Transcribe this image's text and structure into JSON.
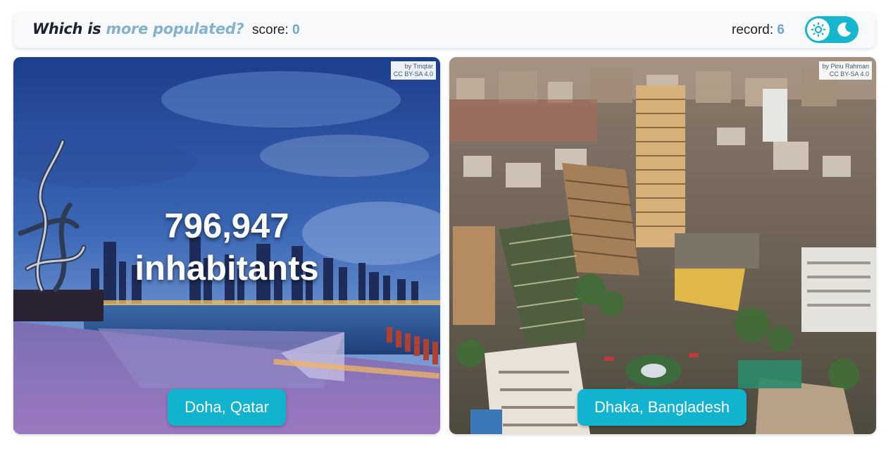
{
  "header": {
    "title_part1": "Which is ",
    "title_part2": "more populated?",
    "score_label": "score: ",
    "score_value": "0",
    "record_label": "record: ",
    "record_value": "6",
    "theme_toggle": {
      "left_icon": "sun-icon",
      "right_icon": "moon-icon",
      "active": "light"
    }
  },
  "cards": [
    {
      "credit_line1": "by Tmqtar",
      "credit_line2": "CC BY-SA 4.0",
      "population": "796,947",
      "population_unit": "inhabitants",
      "city": "Doha, Qatar"
    },
    {
      "credit_line1": "by Pinu Rahman",
      "credit_line2": "CC BY-SA 4.0",
      "city": "Dhaka, Bangladesh"
    }
  ],
  "colors": {
    "accent": "#12b3cf",
    "title_accent": "#84b2cd",
    "score_value": "#6da8c8",
    "header_bg": "#f8f9fa"
  }
}
